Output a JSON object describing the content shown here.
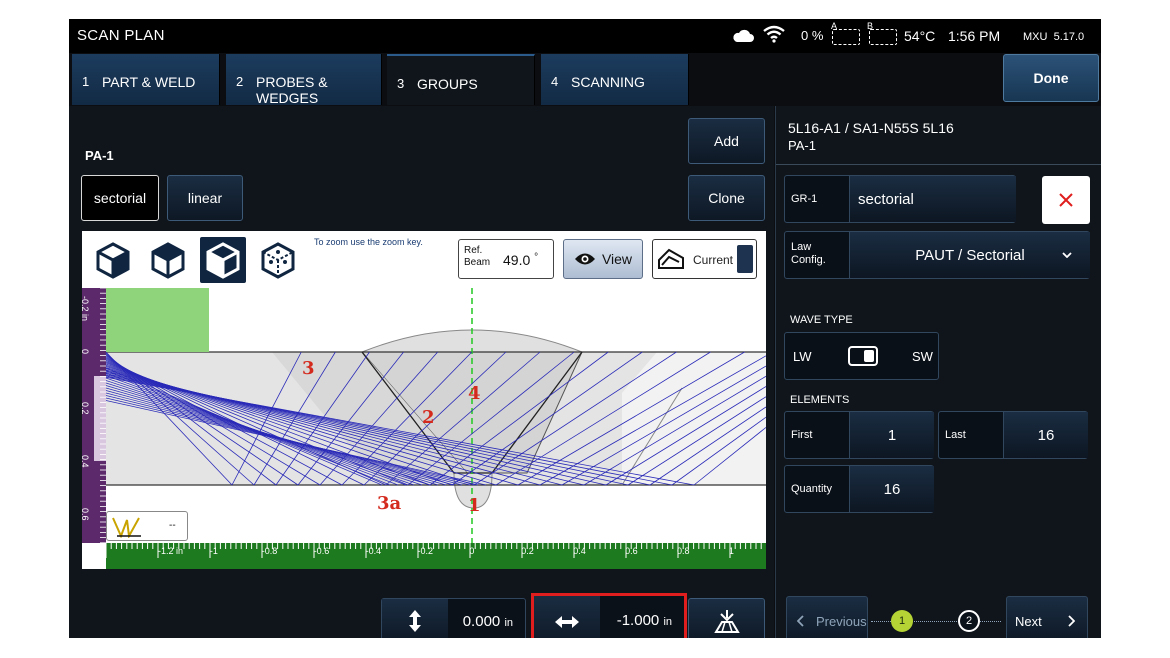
{
  "status_bar": {
    "title": "SCAN PLAN",
    "battery": "0 %",
    "slot_a": "A",
    "slot_b": "B",
    "temperature": "54°C",
    "time": "1:56 PM",
    "device": "MXU",
    "version": "5.17.0"
  },
  "tabs": [
    {
      "num": "1",
      "label": "PART & WELD",
      "active": false
    },
    {
      "num": "2",
      "label": "PROBES & WEDGES",
      "active": false
    },
    {
      "num": "3",
      "label": "GROUPS",
      "active": true
    },
    {
      "num": "4",
      "label": "SCANNING",
      "active": false
    }
  ],
  "done_label": "Done",
  "left": {
    "group_name": "PA-1",
    "modes": [
      "sectorial",
      "linear"
    ],
    "selected_mode": "sectorial",
    "add_label": "Add",
    "clone_label": "Clone",
    "zoom_hint": "To zoom use the zoom key.",
    "ref_beam": {
      "label_1": "Ref.",
      "label_2": "Beam",
      "value": "49.0",
      "unit": "°"
    },
    "view_label": "View",
    "current_label": "Current",
    "view_cubes": [
      "cube-front-icon",
      "cube-iso-icon",
      "cube-side-icon",
      "cube-dashed-icon"
    ],
    "selected_cube": 2,
    "vertical_ruler": {
      "unit": "in",
      "ticks": [
        "-0.2 in",
        "0",
        "0.2",
        "0.4",
        "0.6"
      ]
    },
    "horizontal_ruler": {
      "ticks": [
        "-1.2 in",
        "-1",
        "-0.8",
        "-0.6",
        "-0.4",
        "-0.2",
        "0",
        "0.2",
        "0.4",
        "0.6",
        "0.8",
        "1"
      ]
    },
    "zone_labels": [
      "3",
      "2",
      "4",
      "3a",
      "1"
    ],
    "legend_value": "--",
    "index_offset": {
      "value": "0.000",
      "unit": "in"
    },
    "scan_offset": {
      "value": "-1.000",
      "unit": "in"
    },
    "accent_red": "#e01e1e",
    "ruler_green": "#1e7a1e"
  },
  "right": {
    "probe_title": "5L16-A1 / SA1-N55S 5L16",
    "probe_sub": "PA-1",
    "group_label": "GR-1",
    "group_value": "sectorial",
    "law_label_1": "Law",
    "law_label_2": "Config.",
    "law_value": "PAUT / Sectorial",
    "wave_type_label": "WAVE TYPE",
    "wave_left": "LW",
    "wave_right": "SW",
    "elements_label": "ELEMENTS",
    "first_label": "First",
    "first_value": "1",
    "last_label": "Last",
    "last_value": "16",
    "quantity_label": "Quantity",
    "quantity_value": "16",
    "previous_label": "Previous",
    "next_label": "Next",
    "steps": [
      "1",
      "2"
    ],
    "step_active_color": "#b5d334"
  }
}
